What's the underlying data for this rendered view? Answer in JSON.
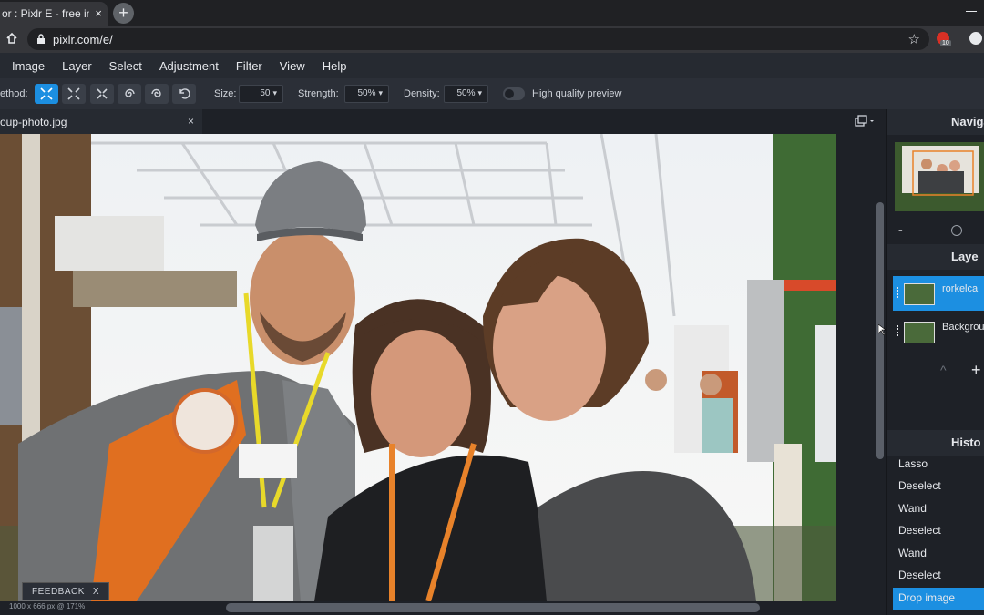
{
  "browser": {
    "tab_title": "or : Pixlr E - free image",
    "tab_close": "×",
    "new_tab": "+",
    "url": "pixlr.com/e/",
    "ext_badge": "10"
  },
  "menu": [
    "Image",
    "Layer",
    "Select",
    "Adjustment",
    "Filter",
    "View",
    "Help"
  ],
  "options": {
    "method_label": "ethod:",
    "size_label": "Size:",
    "size_value": "50",
    "strength_label": "Strength:",
    "strength_value": "50%",
    "density_label": "Density:",
    "density_value": "50%",
    "hq_label": "High quality preview"
  },
  "document": {
    "tab_name": "oup-photo.jpg",
    "close": "×",
    "status": "1000 x 666 px @ 171%"
  },
  "feedback": {
    "label": "FEEDBACK",
    "close": "X"
  },
  "panels": {
    "navigator": "Naviga",
    "zoom_minus": "-",
    "layers_title": "Laye",
    "layers": [
      {
        "name": "rorkelca",
        "selected": true
      },
      {
        "name": "Backgrou",
        "selected": false
      }
    ],
    "layer_up": "^",
    "layer_add": "+",
    "history_title": "Histo",
    "history": [
      "Lasso",
      "Deselect",
      "Wand",
      "Deselect",
      "Wand",
      "Deselect",
      "Drop image"
    ]
  },
  "colors": {
    "accent": "#1c8fe1",
    "panel_bg": "#1e2127"
  }
}
